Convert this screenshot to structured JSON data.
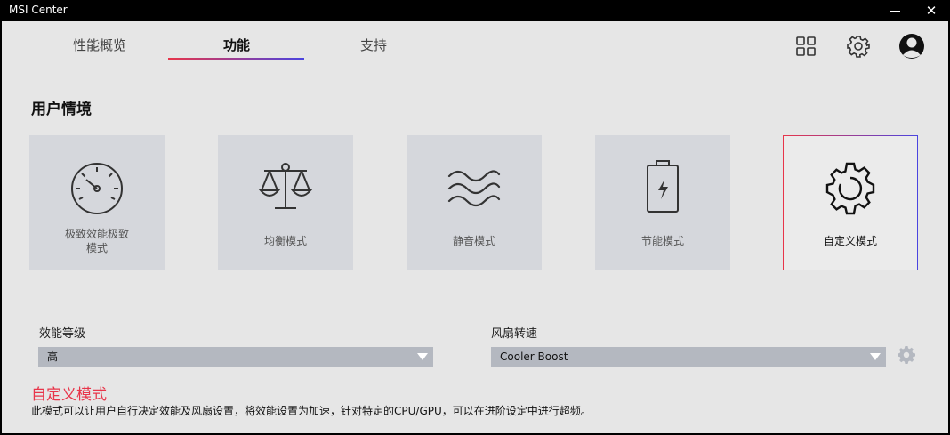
{
  "app": {
    "title": "MSI Center"
  },
  "tabs": [
    {
      "label": "性能概览"
    },
    {
      "label": "功能"
    },
    {
      "label": "支持"
    }
  ],
  "active_tab": "功能",
  "section": {
    "title": "用户情境"
  },
  "scenarios": [
    {
      "label_line1": "极致效能极致",
      "label_line2": "模式",
      "icon": "speedometer-icon"
    },
    {
      "label_line1": "均衡模式",
      "icon": "balance-scale-icon"
    },
    {
      "label_line1": "静音模式",
      "icon": "waves-icon"
    },
    {
      "label_line1": "节能模式",
      "icon": "battery-icon"
    },
    {
      "label_line1": "自定义模式",
      "icon": "gear-icon",
      "selected": true
    }
  ],
  "performance": {
    "label": "效能等级",
    "value": "高"
  },
  "fan": {
    "label": "风扇转速",
    "value": "Cooler Boost"
  },
  "mode": {
    "title": "自定义模式",
    "description": "此模式可以让用户自行决定效能及风扇设置，将效能设置为加速，针对特定的CPU/GPU，可以在进阶设定中进行超频。"
  },
  "colors": {
    "accent_red": "#e8354a",
    "accent_blue": "#4a44e0"
  }
}
